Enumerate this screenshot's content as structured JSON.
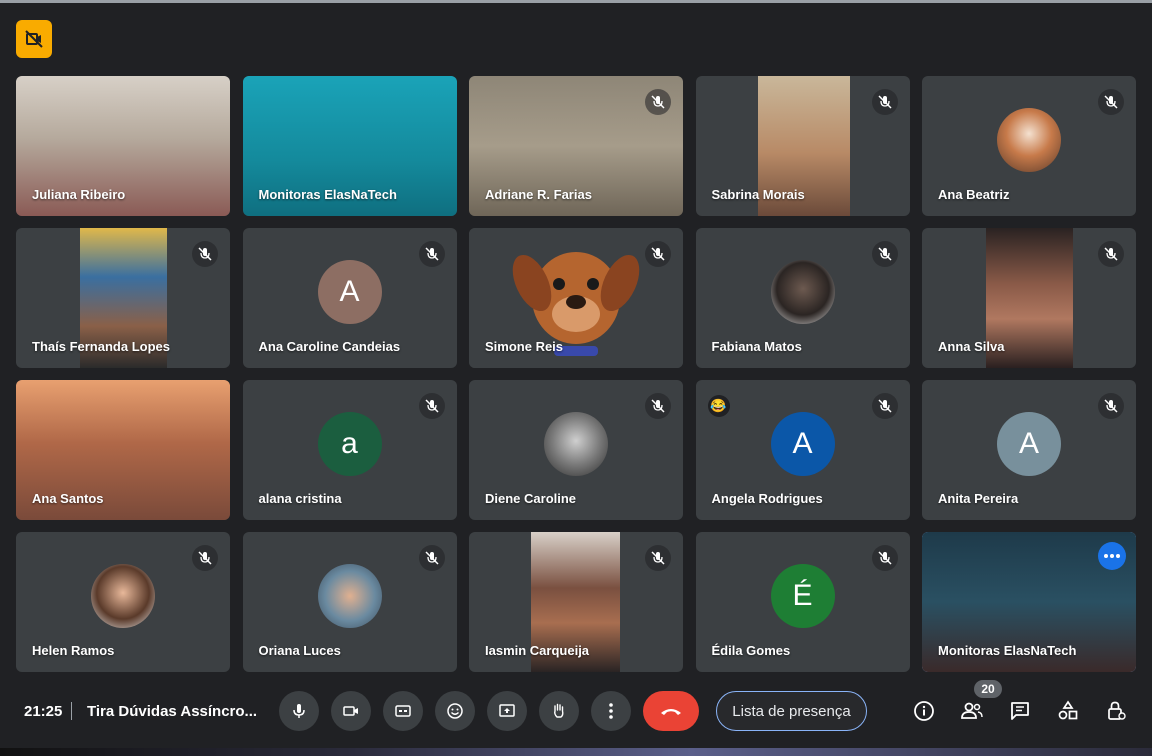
{
  "participants": [
    {
      "name": "Juliana Ribeiro",
      "muted": false,
      "video": true
    },
    {
      "name": "Monitoras ElasNaTech",
      "muted": false,
      "video": true
    },
    {
      "name": "Adriane R. Farias",
      "muted": true,
      "video": true
    },
    {
      "name": "Sabrina Morais",
      "muted": true,
      "video": true
    },
    {
      "name": "Ana Beatriz",
      "muted": true,
      "avatar_photo": true
    },
    {
      "name": "Thaís Fernanda Lopes",
      "muted": true,
      "video": true
    },
    {
      "name": "Ana Caroline Candeias",
      "muted": true,
      "avatar_letter": "A",
      "avatar_color": "#8d6e63"
    },
    {
      "name": "Simone Reis",
      "muted": true,
      "video": true
    },
    {
      "name": "Fabiana Matos",
      "muted": true,
      "avatar_photo": true
    },
    {
      "name": "Anna Silva",
      "muted": true,
      "video": true
    },
    {
      "name": "Ana Santos",
      "muted": false,
      "video": true
    },
    {
      "name": "alana cristina",
      "muted": true,
      "avatar_letter": "a",
      "avatar_color": "#1b5e3f"
    },
    {
      "name": "Diene Caroline",
      "muted": true,
      "avatar_photo": true
    },
    {
      "name": "Angela Rodrigues",
      "muted": true,
      "avatar_letter": "A",
      "avatar_color": "#0b57a8",
      "reaction": "😂"
    },
    {
      "name": "Anita Pereira",
      "muted": true,
      "avatar_letter": "A",
      "avatar_color": "#78909c"
    },
    {
      "name": "Helen Ramos",
      "muted": true,
      "avatar_photo": true
    },
    {
      "name": "Oriana Luces",
      "muted": true,
      "avatar_photo": true
    },
    {
      "name": "Iasmin Carqueija",
      "muted": true,
      "video": true
    },
    {
      "name": "Édila Gomes",
      "muted": true,
      "avatar_letter": "É",
      "avatar_color": "#1e7e34"
    },
    {
      "name": "Monitoras ElasNaTech",
      "muted": false,
      "video": true,
      "active": true
    }
  ],
  "bottom_bar": {
    "time": "21:25",
    "meeting_title": "Tira Dúvidas Assíncro...",
    "attendance_button": "Lista de presença",
    "participant_count": "20"
  },
  "colors": {
    "background": "#202124",
    "tile": "#3c4043",
    "hangup": "#ea4335",
    "recording_badge": "#f9ab00",
    "accent": "#8ab4f8"
  }
}
